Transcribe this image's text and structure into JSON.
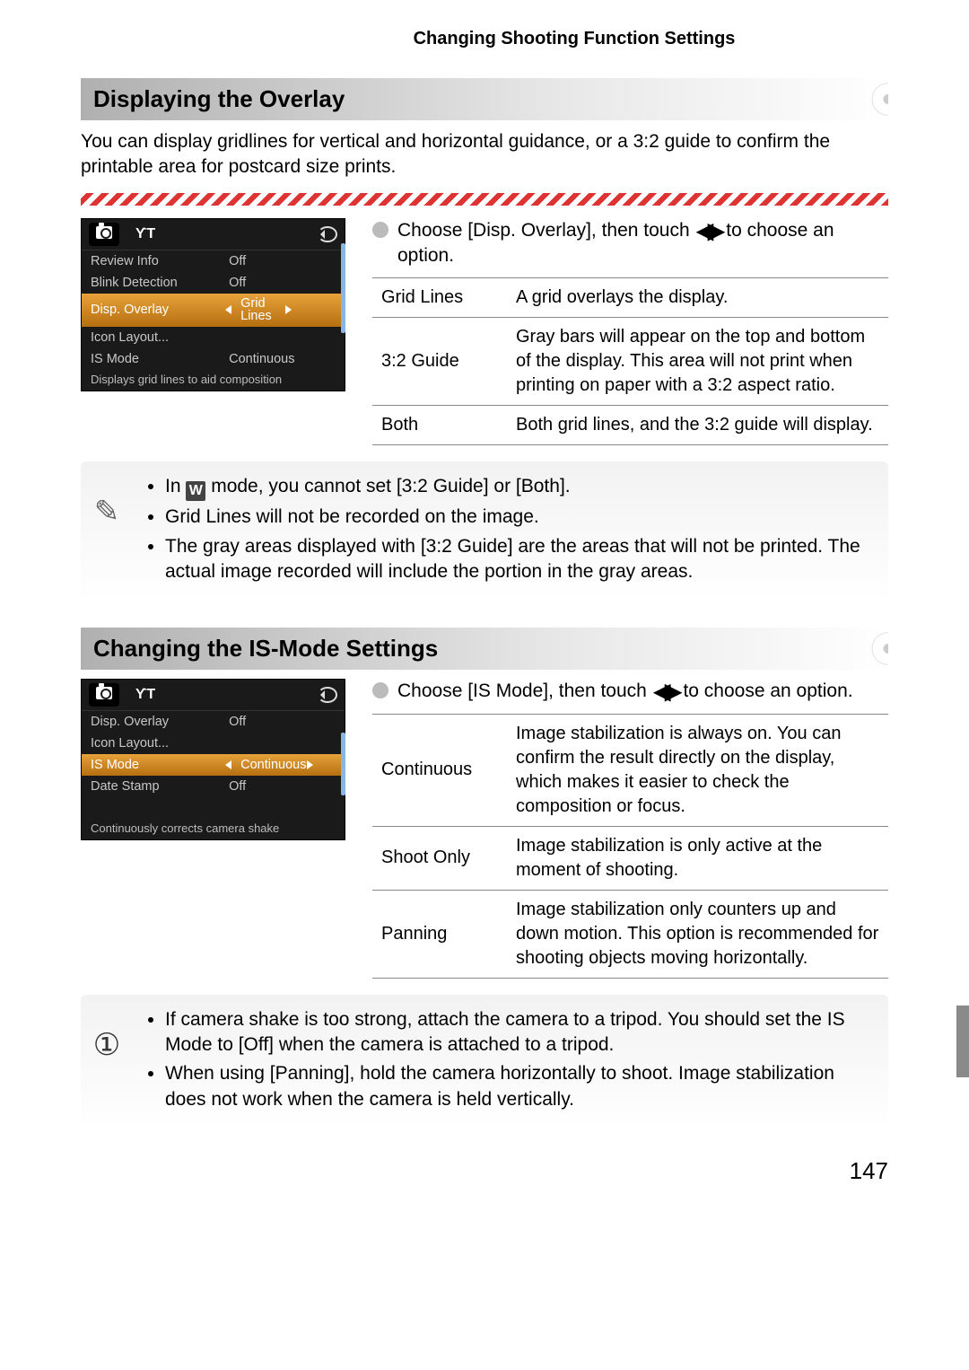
{
  "header": {
    "title": "Changing Shooting Function Settings"
  },
  "page_number": "147",
  "section1": {
    "heading": "Displaying the Overlay",
    "intro": "You can display gridlines for vertical and horizontal guidance, or a 3:2 guide to confirm the printable area for postcard size prints.",
    "menu": {
      "tabs": {
        "tool": "ϒT"
      },
      "rows": [
        {
          "label": "Review Info",
          "value": "Off"
        },
        {
          "label": "Blink Detection",
          "value": "Off"
        },
        {
          "label": "Disp. Overlay",
          "value": "Grid Lines",
          "selected": true
        },
        {
          "label": "Icon Layout...",
          "value": ""
        },
        {
          "label": "IS Mode",
          "value": "Continuous"
        }
      ],
      "hint": "Displays grid lines to aid composition"
    },
    "step_pre": "Choose [Disp. Overlay], then touch ",
    "step_post": " to choose an option.",
    "table": [
      {
        "name": "Grid Lines",
        "desc": "A grid overlays the display."
      },
      {
        "name": "3:2 Guide",
        "desc": "Gray bars will appear on the top and bottom of the display. This area will not print when printing on paper with a 3:2 aspect ratio."
      },
      {
        "name": "Both",
        "desc": "Both grid lines, and the 3:2 guide will display."
      }
    ],
    "notes": {
      "n1_pre": "In ",
      "n1_post": " mode, you cannot set [3:2 Guide] or [Both].",
      "n2": "Grid Lines will not be recorded on the image.",
      "n3": "The gray areas displayed with [3:2 Guide] are the areas that will not be printed. The actual image recorded will include the portion in the gray areas."
    }
  },
  "section2": {
    "heading": "Changing the IS-Mode Settings",
    "menu": {
      "tabs": {
        "tool": "ϒT"
      },
      "rows": [
        {
          "label": "Disp. Overlay",
          "value": "Off"
        },
        {
          "label": "Icon Layout...",
          "value": ""
        },
        {
          "label": "IS Mode",
          "value": "Continuous",
          "selected": true
        },
        {
          "label": "Date Stamp",
          "value": "Off"
        },
        {
          "label": "",
          "value": ""
        }
      ],
      "hint": "Continuously corrects camera shake"
    },
    "step_pre": "Choose [IS Mode], then touch ",
    "step_post": " to choose an option.",
    "table": [
      {
        "name": "Continuous",
        "desc": "Image stabilization is always on. You can confirm the result directly on the display, which makes it easier to check the composition or focus."
      },
      {
        "name": "Shoot Only",
        "desc": "Image stabilization is only active at the moment of shooting."
      },
      {
        "name": "Panning",
        "desc": "Image stabilization only counters up and down motion. This option is recommended for shooting objects moving horizontally."
      }
    ],
    "caution": {
      "c1": "If camera shake is too strong, attach the camera to a tripod. You should set the IS Mode to [Off] when the camera is attached to a tripod.",
      "c2": "When using [Panning], hold the camera horizontally to shoot. Image stabilization does not work when the camera is held vertically."
    }
  }
}
